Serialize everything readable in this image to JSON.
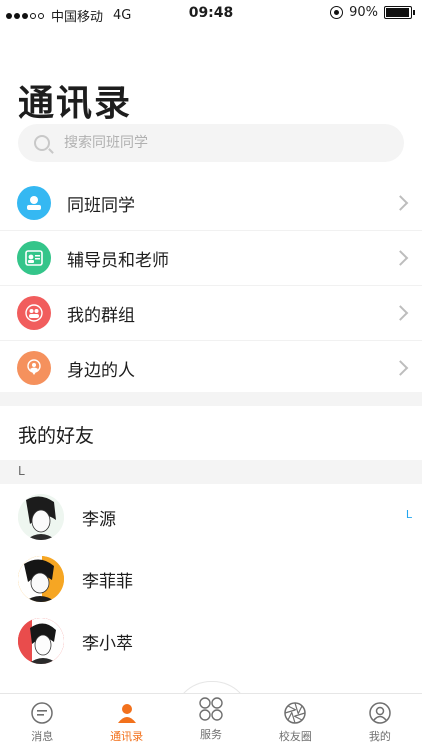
{
  "status": {
    "carrier": "中国移动",
    "network": "4G",
    "time": "09:48",
    "battery": "90%"
  },
  "page": {
    "title": "通讯录"
  },
  "search": {
    "placeholder": "搜索同班同学"
  },
  "menu": [
    {
      "label": "同班同学",
      "icon": "classmates-icon",
      "color": "#35b8f2"
    },
    {
      "label": "辅导员和老师",
      "icon": "teacher-icon",
      "color": "#34c58a"
    },
    {
      "label": "我的群组",
      "icon": "group-icon",
      "color": "#f15d5d"
    },
    {
      "label": "身边的人",
      "icon": "nearby-icon",
      "color": "#f5915d"
    }
  ],
  "friends": {
    "title": "我的好友",
    "letter": "L",
    "index_letter": "L",
    "list": [
      {
        "name": "李源"
      },
      {
        "name": "李菲菲"
      },
      {
        "name": "李小萃"
      }
    ]
  },
  "tabs": [
    {
      "label": "消息",
      "icon": "message-icon",
      "active": false
    },
    {
      "label": "通讯录",
      "icon": "contacts-icon",
      "active": true
    },
    {
      "label": "服务",
      "icon": "service-icon",
      "active": false
    },
    {
      "label": "校友圈",
      "icon": "moments-icon",
      "active": false
    },
    {
      "label": "我的",
      "icon": "profile-icon",
      "active": false
    }
  ],
  "colors": {
    "accent": "#f2711c",
    "index": "#23a6f0"
  }
}
